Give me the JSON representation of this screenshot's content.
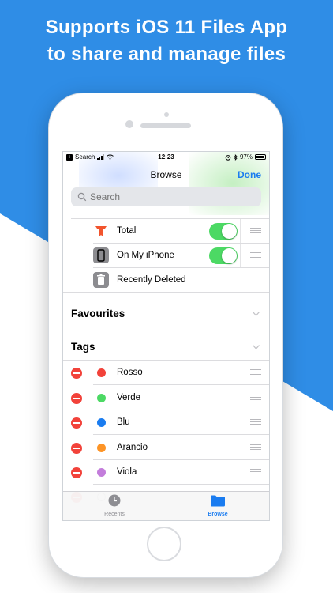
{
  "headline": {
    "line1": "Supports iOS 11 Files App",
    "line2": "to share and manage files"
  },
  "status_bar": {
    "back_app": "Search",
    "time": "12:23",
    "battery": "97%"
  },
  "nav": {
    "title": "Browse",
    "done": "Done"
  },
  "search": {
    "placeholder": "Search"
  },
  "locations": [
    {
      "label": "Total",
      "icon": "total-app-icon",
      "toggle": true
    },
    {
      "label": "On My iPhone",
      "icon": "iphone-icon",
      "toggle": true
    },
    {
      "label": "Recently Deleted",
      "icon": "trash-icon",
      "toggle": null
    }
  ],
  "sections": {
    "favourites": "Favourites",
    "tags": "Tags"
  },
  "tags": [
    {
      "label": "Rosso",
      "color": "#f2423a"
    },
    {
      "label": "Verde",
      "color": "#4cd964"
    },
    {
      "label": "Blu",
      "color": "#1a7cf0"
    },
    {
      "label": "Arancio",
      "color": "#fd9426"
    },
    {
      "label": "Viola",
      "color": "#c37ddb"
    }
  ],
  "tabbar": {
    "recents": "Recents",
    "browse": "Browse"
  },
  "colors": {
    "accent": "#1a7cf0",
    "background": "#2f8de6",
    "toggle_on": "#4cd964",
    "delete": "#f2423a"
  }
}
